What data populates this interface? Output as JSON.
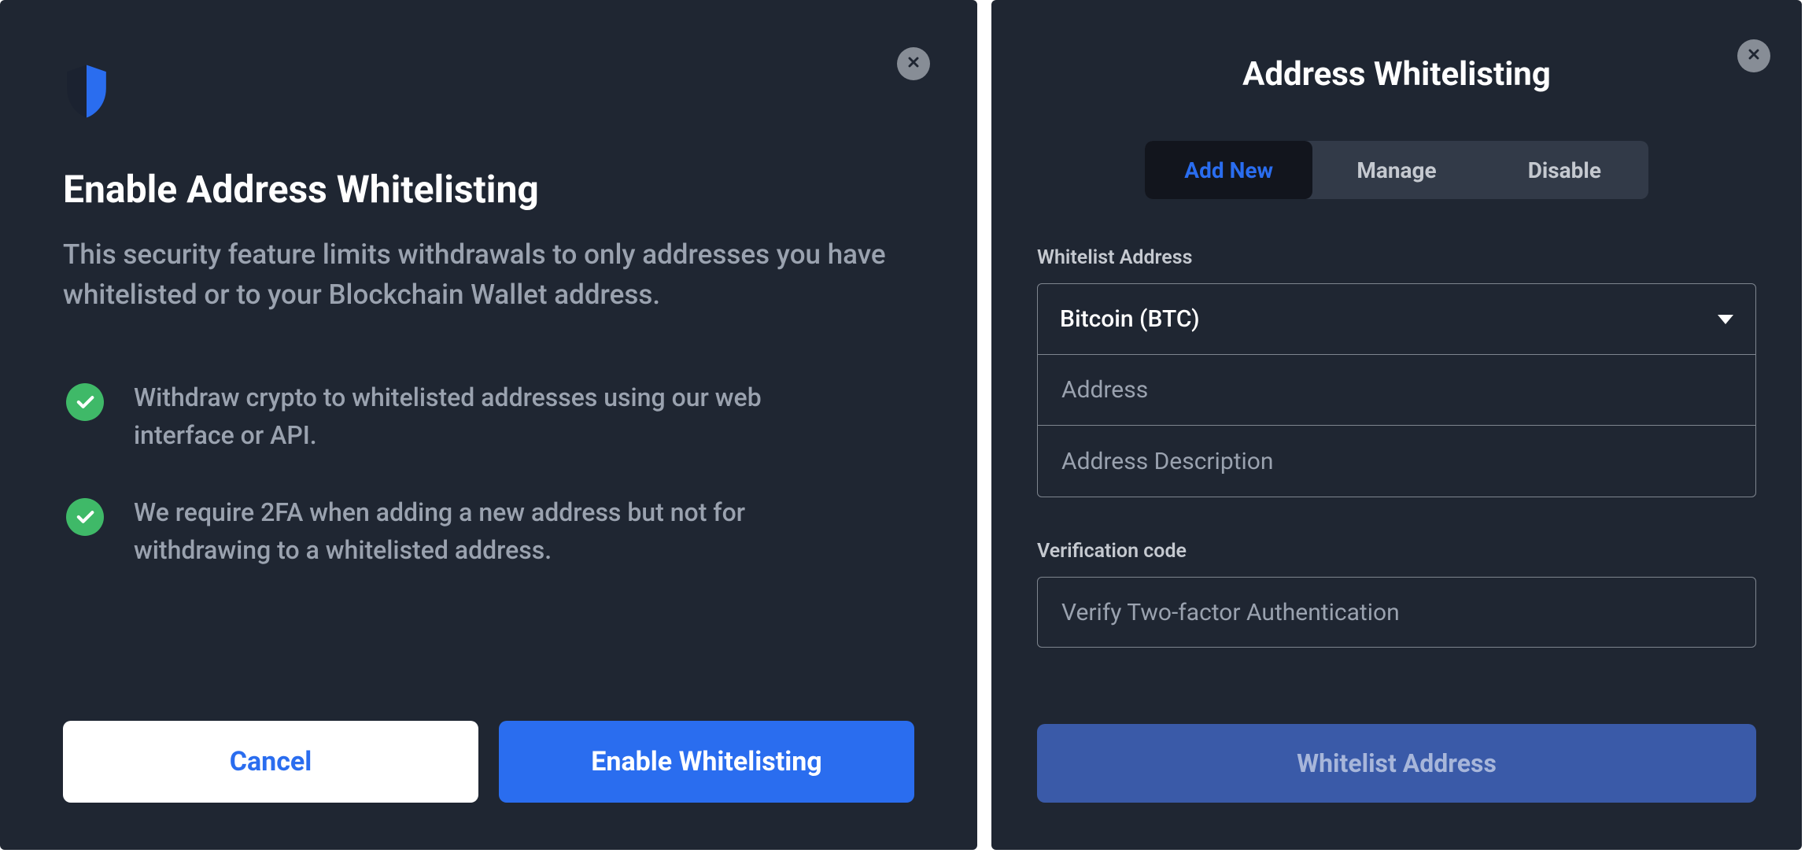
{
  "left_modal": {
    "title": "Enable Address Whitelisting",
    "subtitle": "This security feature limits withdrawals to only addresses you have whitelisted or to your Blockchain Wallet address.",
    "bullets": [
      "Withdraw crypto to whitelisted addresses using our web interface or API.",
      "We require 2FA when adding a new address but not for withdrawing to a whitelisted address."
    ],
    "cancel_label": "Cancel",
    "primary_label": "Enable Whitelisting"
  },
  "right_modal": {
    "title": "Address Whitelisting",
    "tabs": [
      "Add New",
      "Manage",
      "Disable"
    ],
    "active_tab_index": 0,
    "whitelist_section_label": "Whitelist Address",
    "currency_selected": "Bitcoin (BTC)",
    "address_placeholder": "Address",
    "description_placeholder": "Address Description",
    "verification_label": "Verification code",
    "verification_placeholder": "Verify Two-factor Authentication",
    "submit_label": "Whitelist Address"
  }
}
